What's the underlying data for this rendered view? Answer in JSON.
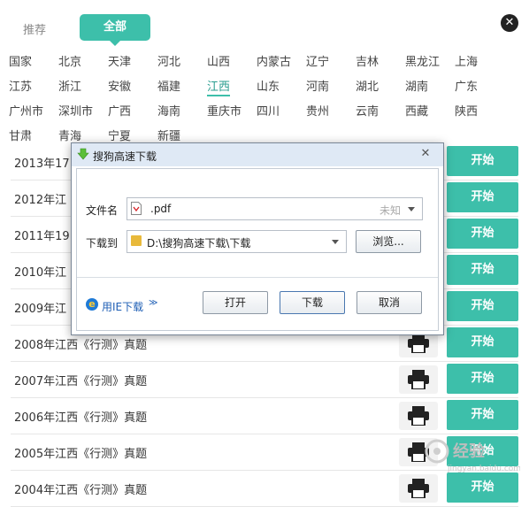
{
  "tabs": {
    "recommended": "推荐",
    "all": "全部"
  },
  "regions": [
    [
      "国家",
      "北京",
      "天津",
      "河北",
      "山西",
      "内蒙古",
      "辽宁",
      "吉林",
      "黑龙江",
      "上海"
    ],
    [
      "江苏",
      "浙江",
      "安徽",
      "福建",
      "江西",
      "山东",
      "河南",
      "湖北",
      "湖南",
      "广东"
    ],
    [
      "广州市",
      "深圳市",
      "广西",
      "海南",
      "重庆市",
      "四川",
      "贵州",
      "云南",
      "西藏",
      "陕西"
    ],
    [
      "甘肃",
      "青海",
      "宁夏",
      "新疆"
    ]
  ],
  "active_region": "江西",
  "exam_list": {
    "start_label": "开始",
    "items": [
      "2013年17",
      "2012年江",
      "2011年19",
      "2010年江",
      "2009年江",
      "2008年江西《行测》真题",
      "2007年江西《行测》真题",
      "2006年江西《行测》真题",
      "2005年江西《行测》真题",
      "2004年江西《行测》真题"
    ]
  },
  "dialog": {
    "title": "搜狗高速下载",
    "filename_label": "文件名",
    "filename_value": ".pdf",
    "filename_hint": "未知",
    "saveto_label": "下载到",
    "saveto_value": "D:\\搜狗高速下载\\下载",
    "browse_label": "浏览...",
    "ie_download_label": "用IE下载",
    "open_label": "打开",
    "download_label": "下载",
    "cancel_label": "取消"
  },
  "watermark": {
    "text": "经验",
    "sub": "jingyan.baidu.com"
  },
  "colors": {
    "accent": "#3dbfaa",
    "dialog_title": "#dfe9f5"
  }
}
